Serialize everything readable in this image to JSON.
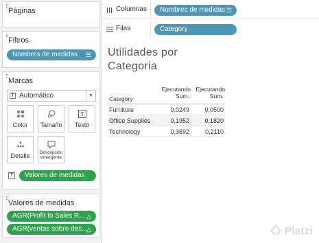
{
  "left_panel": {
    "pages": {
      "title": "Páginas"
    },
    "filters": {
      "title": "Filtros",
      "pill_label": "Nombres de medidas"
    },
    "marks": {
      "title": "Marcas",
      "mark_type": "Automático",
      "buttons": [
        {
          "label": "Color",
          "icon": "color-dots-icon"
        },
        {
          "label": "Tamaño",
          "icon": "size-icon"
        },
        {
          "label": "Texto",
          "icon": "text-icon"
        },
        {
          "label": "Detalle",
          "icon": "detail-icon"
        },
        {
          "label": "Descripción emergente",
          "icon": "tooltip-icon"
        }
      ],
      "text_pill": "Valores de medidas"
    },
    "measure_values": {
      "title": "Valores de medidas",
      "pills": [
        {
          "label": "AGR(Profit to Sales R...",
          "icon": "delta-icon"
        },
        {
          "label": "AGR(ventas sobre des...",
          "icon": "delta-icon"
        }
      ]
    }
  },
  "shelves": {
    "columns": {
      "label": "Columnas",
      "pill": "Nombres de medidas"
    },
    "rows": {
      "label": "Filas",
      "pill": "Category"
    }
  },
  "viz": {
    "title_line1": "Utilidades por",
    "title_line2": "Categoria",
    "table": {
      "row_header": "Category",
      "col_headers": [
        {
          "line1": "Ejecutando",
          "line2": "Sum.."
        },
        {
          "line1": "Ejecutando",
          "line2": "Sum.."
        }
      ],
      "rows": [
        {
          "category": "Furniture",
          "values": [
            "0,0249",
            "0,0500"
          ]
        },
        {
          "category": "Office Supplies",
          "values": [
            "0,1952",
            "0,1820"
          ]
        },
        {
          "category": "Technology",
          "values": [
            "0,3692",
            "0,2110"
          ]
        }
      ]
    }
  },
  "watermark": {
    "brand": "Platzi"
  },
  "colors": {
    "blue_pill": "#4d97b4",
    "green_pill": "#2fa14f"
  }
}
